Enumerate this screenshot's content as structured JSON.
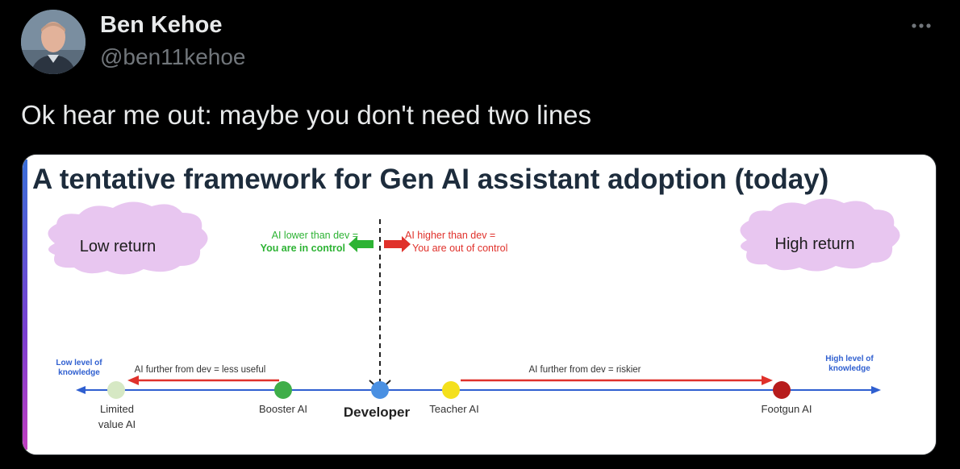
{
  "tweet": {
    "author_name": "Ben Kehoe",
    "author_handle": "@ben11kehoe",
    "text": "Ok hear me out: maybe you don't need two lines",
    "more_icon": "ellipsis-icon"
  },
  "slide": {
    "title": "A tentative framework for Gen AI assistant adoption (today)",
    "low_return": "Low return",
    "high_return": "High return",
    "ai_lower_line1": "AI lower than dev =",
    "ai_lower_line2": "You are in control",
    "ai_higher_line1": "AI higher than dev =",
    "ai_higher_line2": "You are out of control",
    "low_knowledge_line1": "Low level of",
    "low_knowledge_line2": "knowledge",
    "high_knowledge_line1": "High level of",
    "high_knowledge_line2": "knowledge",
    "further_less_useful": "AI further from dev = less useful",
    "further_riskier": "AI further from dev = riskier",
    "points": [
      {
        "label_line1": "Limited",
        "label_line2": "value AI",
        "color": "#d6e8c4"
      },
      {
        "label_line1": "Booster AI",
        "label_line2": "",
        "color": "#3fae49"
      },
      {
        "label_line1": "Developer",
        "label_line2": "",
        "color": "#4a90e2"
      },
      {
        "label_line1": "Teacher AI",
        "label_line2": "",
        "color": "#f4e01c"
      },
      {
        "label_line1": "Footgun AI",
        "label_line2": "",
        "color": "#b71c1c"
      }
    ],
    "colors": {
      "cloud": "#e8c6f0",
      "green": "#2db334",
      "red": "#e0312b",
      "blue": "#2f5fd0",
      "left_accent_top": "#3a6fd8",
      "left_accent_bottom": "#c03fc0"
    }
  }
}
